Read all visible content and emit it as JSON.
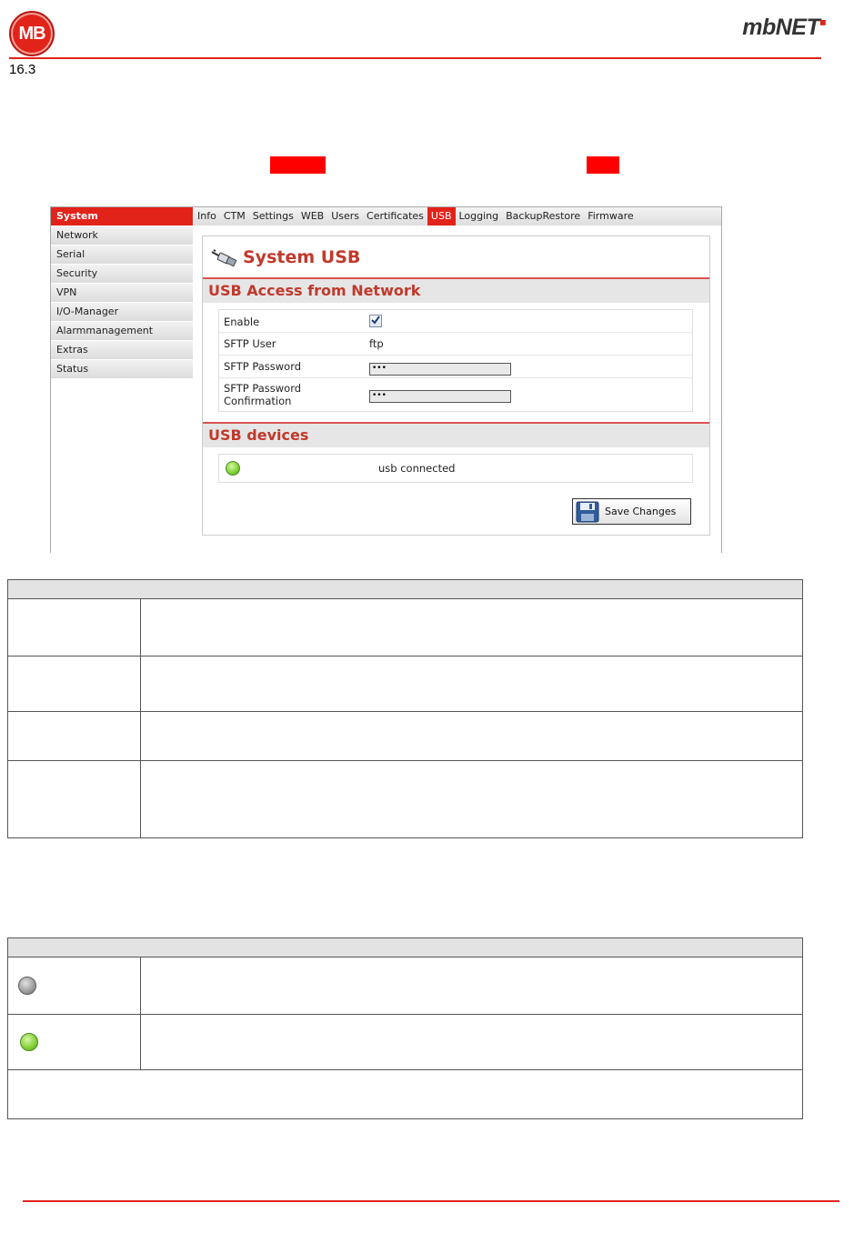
{
  "header": {
    "logo_left": "MB",
    "logo_right": "mbNET",
    "section_number": "16.3"
  },
  "screenshot": {
    "sidebar": {
      "items": [
        {
          "label": "System",
          "active": true
        },
        {
          "label": "Network"
        },
        {
          "label": "Serial"
        },
        {
          "label": "Security"
        },
        {
          "label": "VPN"
        },
        {
          "label": "I/O-Manager"
        },
        {
          "label": "Alarmmanagement"
        },
        {
          "label": "Extras"
        },
        {
          "label": "Status"
        }
      ]
    },
    "tabs": [
      {
        "label": "Info"
      },
      {
        "label": "CTM"
      },
      {
        "label": "Settings"
      },
      {
        "label": "WEB"
      },
      {
        "label": "Users"
      },
      {
        "label": "Certificates"
      },
      {
        "label": "USB",
        "active": true
      },
      {
        "label": "Logging"
      },
      {
        "label": "BackupRestore"
      },
      {
        "label": "Firmware"
      }
    ],
    "panel_title": "System USB",
    "access_section": {
      "title": "USB Access from Network",
      "enable_label": "Enable",
      "enable_checked": true,
      "sftp_user_label": "SFTP User",
      "sftp_user_value": "ftp",
      "sftp_password_label": "SFTP Password",
      "sftp_password_value": "•••",
      "sftp_confirm_label_1": "SFTP Password",
      "sftp_confirm_label_2": "Confirmation",
      "sftp_confirm_value": "•••"
    },
    "devices_section": {
      "title": "USB devices",
      "status_text": "usb connected",
      "status_led": "green"
    },
    "save_button": "Save Changes"
  },
  "status_table": {
    "rows": [
      {
        "icon": "grey-led-icon"
      },
      {
        "icon": "green-led-icon"
      }
    ]
  },
  "colors": {
    "brand_red": "#e2231a",
    "section_title": "#c0392b"
  }
}
